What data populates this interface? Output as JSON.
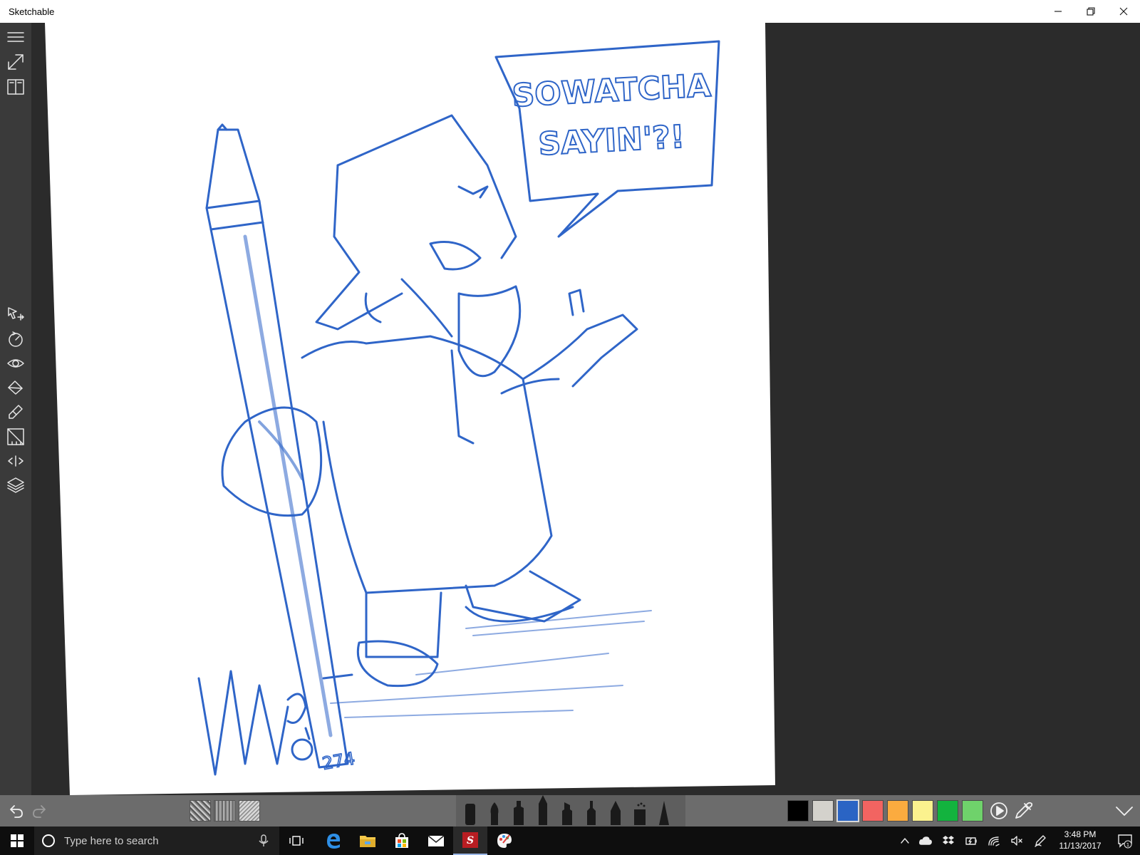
{
  "window": {
    "title": "Sketchable",
    "controls": [
      "minimize",
      "restore",
      "close"
    ]
  },
  "left_toolbar": {
    "top_items": [
      "menu-icon",
      "fullscreen-icon",
      "journal-icon"
    ],
    "tool_items": [
      "select-move-icon",
      "rotate-canvas-icon",
      "view-icon",
      "fill-icon",
      "eraser-icon",
      "ruler-icon",
      "symmetry-icon",
      "layers-icon"
    ]
  },
  "canvas": {
    "speech_bubble_lines": [
      "SOWATCHA",
      "SAYIN'?!"
    ],
    "signature_number": "274",
    "ink_color": "#2f65c8"
  },
  "bottom_toolbar": {
    "undo": "undo-icon",
    "redo": "redo-icon",
    "textures": [
      "texture-1",
      "texture-2",
      "texture-3"
    ],
    "brushes": [
      "marker",
      "brush",
      "ink-pen",
      "pencil",
      "highlighter",
      "felt-tip",
      "fountain-pen",
      "spray",
      "cone"
    ],
    "palette": [
      "#000000",
      "#d4d2cc",
      "#2a64c4",
      "#f26461",
      "#fbab3f",
      "#fbf28e",
      "#13b33e",
      "#6fd26b"
    ],
    "selected_swatch_index": 2
  },
  "taskbar": {
    "search_placeholder": "Type here to search",
    "apps": [
      "task-view",
      "edge",
      "file-explorer",
      "store",
      "mail",
      "sketchable",
      "paint"
    ],
    "clock": {
      "time": "3:48 PM",
      "date": "11/13/2017"
    },
    "notification_count": "1"
  }
}
